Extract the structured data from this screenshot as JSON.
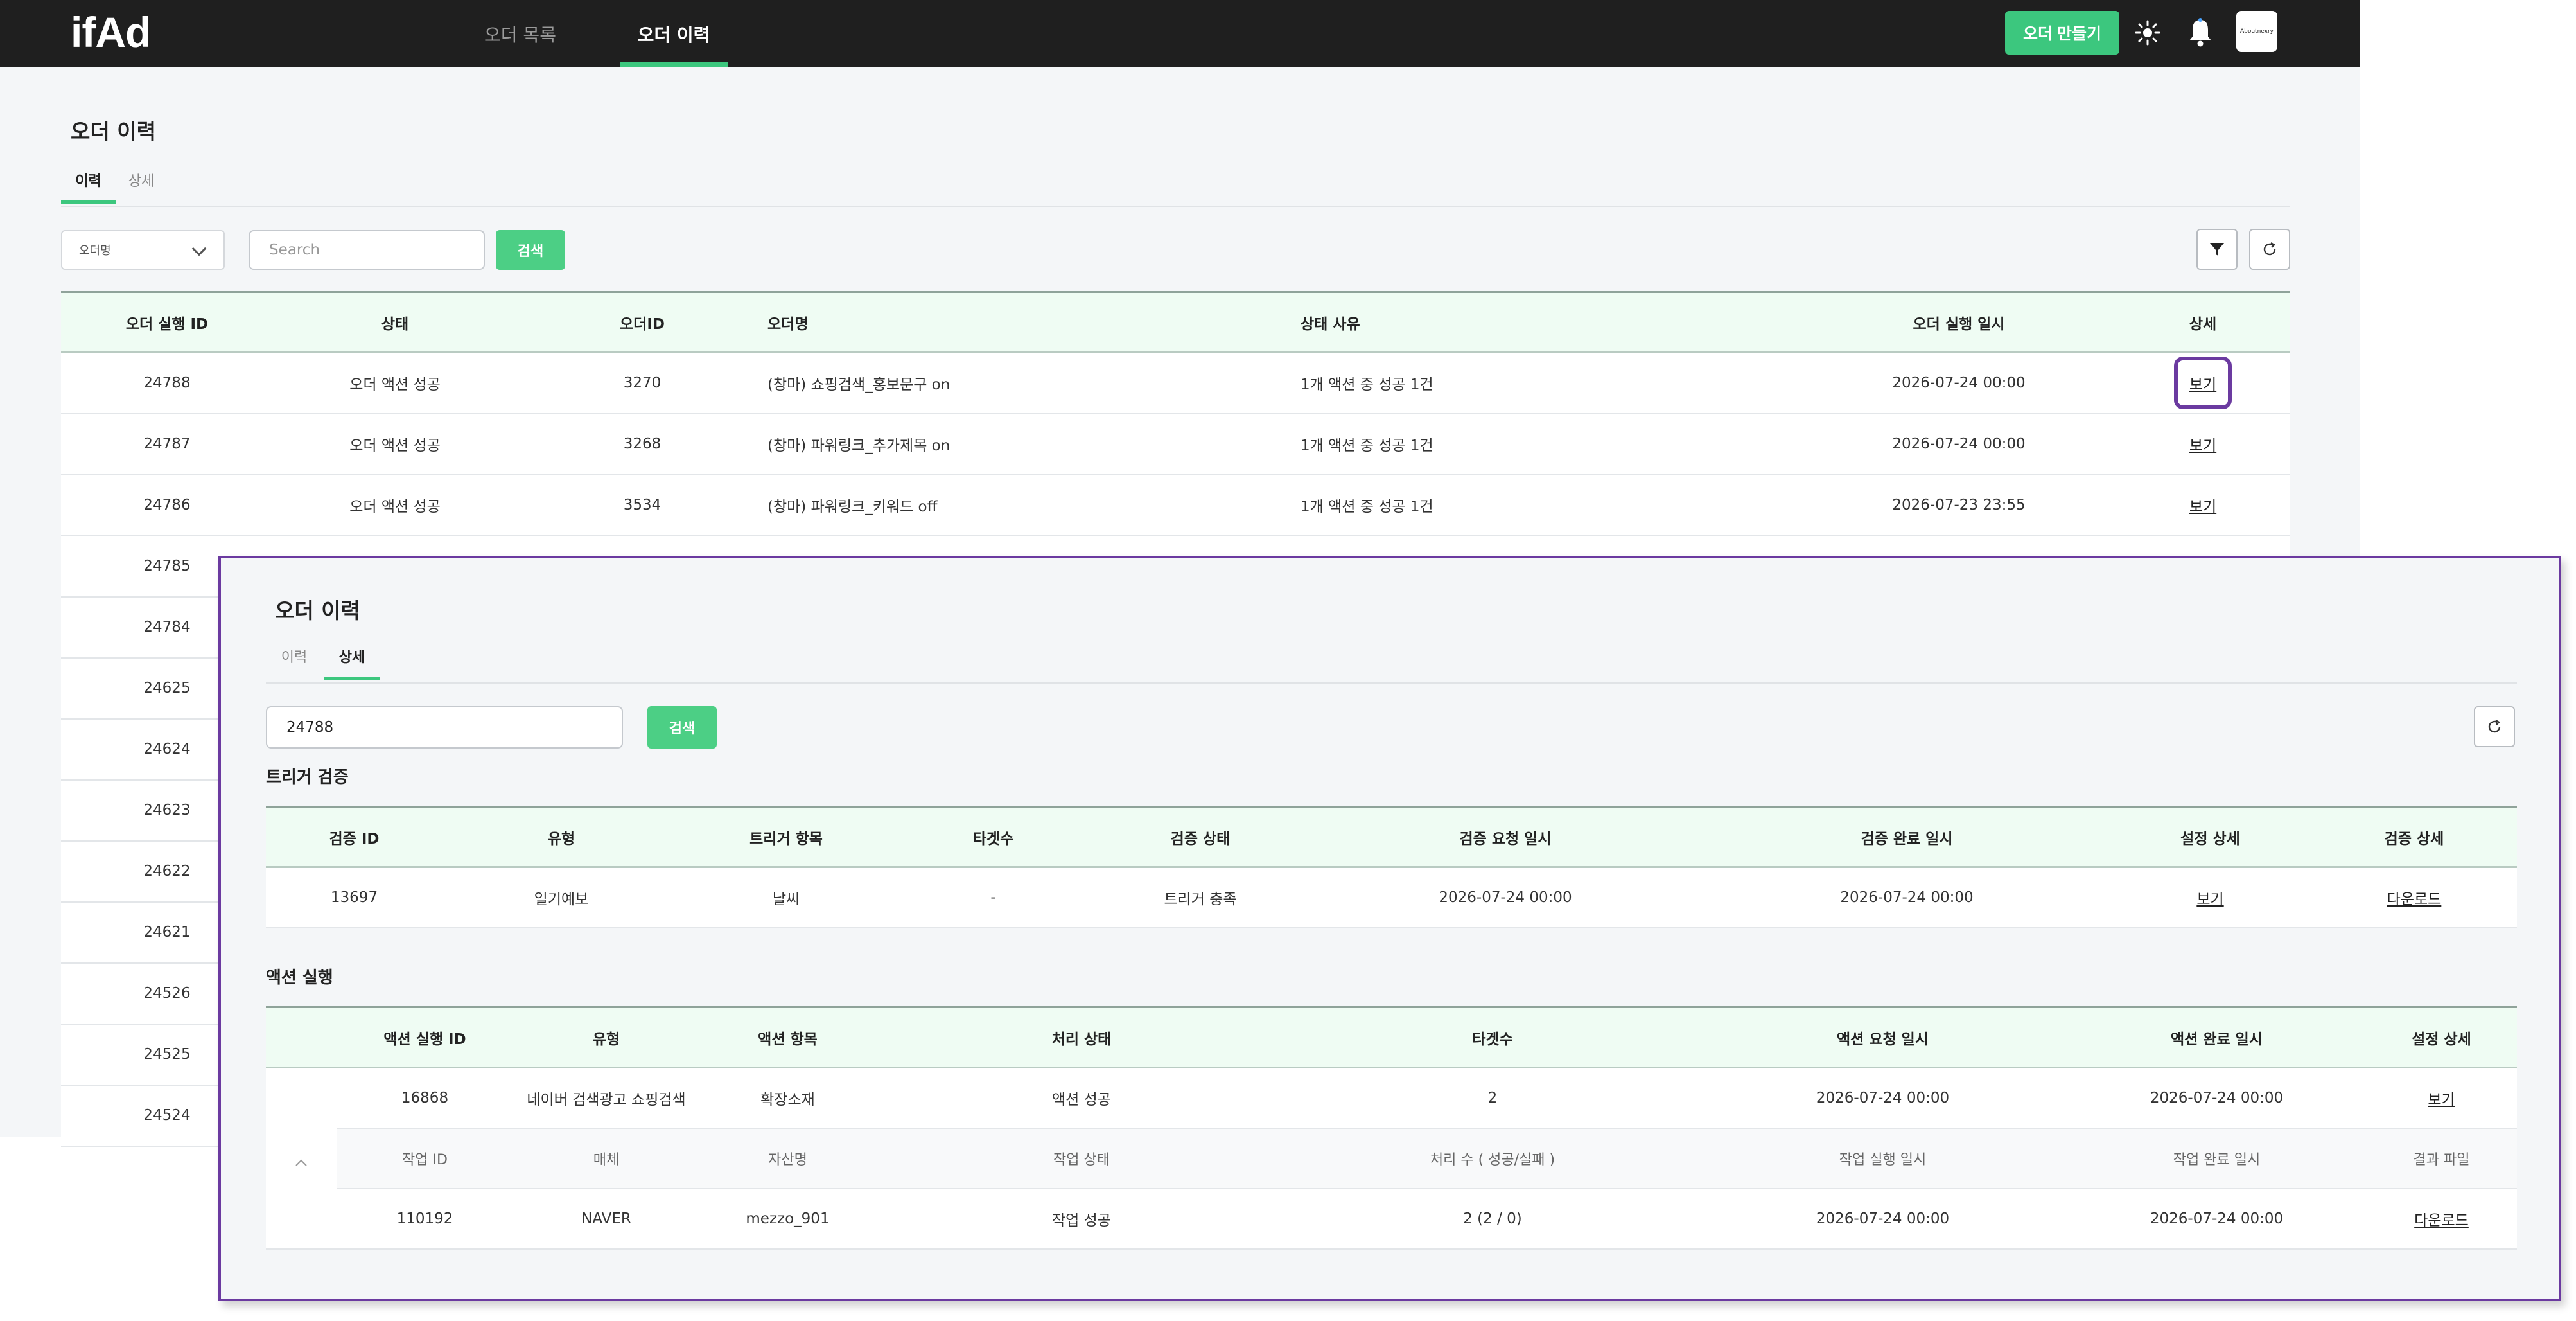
{
  "header": {
    "logo": "ifAd",
    "nav": [
      "오더 목록",
      "오더 이력"
    ],
    "create_button": "오더 만들기",
    "profile_label": "Aboutnexry"
  },
  "list": {
    "title": "오더 이력",
    "tabs": [
      "이력",
      "상세"
    ],
    "filter_select": "오더명",
    "search_placeholder": "Search",
    "search_button": "검색",
    "columns": [
      "오더 실행 ID",
      "상태",
      "오더ID",
      "오더명",
      "상태 사유",
      "오더 실행 일시",
      "상세"
    ],
    "rows": [
      {
        "id": "24788",
        "status": "오더 액션 성공",
        "order_id": "3270",
        "name": "(창마) 쇼핑검색_홍보문구 on",
        "reason": "1개 액션 중 성공 1건",
        "datetime": "2026-07-24 00:00",
        "detail": "보기"
      },
      {
        "id": "24787",
        "status": "오더 액션 성공",
        "order_id": "3268",
        "name": "(창마) 파워링크_추가제목 on",
        "reason": "1개 액션 중 성공 1건",
        "datetime": "2026-07-24 00:00",
        "detail": "보기"
      },
      {
        "id": "24786",
        "status": "오더 액션 성공",
        "order_id": "3534",
        "name": "(창마) 파워링크_키워드 off",
        "reason": "1개 액션 중 성공 1건",
        "datetime": "2026-07-23 23:55",
        "detail": "보기"
      },
      {
        "id": "24785"
      },
      {
        "id": "24784"
      },
      {
        "id": "24625"
      },
      {
        "id": "24624"
      },
      {
        "id": "24623"
      },
      {
        "id": "24622"
      },
      {
        "id": "24621"
      },
      {
        "id": "24526"
      },
      {
        "id": "24525"
      },
      {
        "id": "24524"
      }
    ]
  },
  "detail": {
    "title": "오더 이력",
    "tabs": [
      "이력",
      "상세"
    ],
    "search_value": "24788",
    "search_button": "검색",
    "trigger": {
      "title": "트리거 검증",
      "columns": [
        "검증 ID",
        "유형",
        "트리거 항목",
        "타겟수",
        "검증 상태",
        "검증 요청 일시",
        "검증 완료 일시",
        "설정 상세",
        "검증 상세"
      ],
      "row": [
        "13697",
        "일기예보",
        "날씨",
        "-",
        "트리거 충족",
        "2026-07-24 00:00",
        "2026-07-24 00:00",
        "보기",
        "다운로드"
      ]
    },
    "action": {
      "title": "액션 실행",
      "columns": [
        "액션 실행 ID",
        "유형",
        "액션 항목",
        "처리 상태",
        "타겟수",
        "액션 요청 일시",
        "액션 완료 일시",
        "설정 상세"
      ],
      "row": [
        "16868",
        "네이버 검색광고 쇼핑검색",
        "확장소재",
        "액션 성공",
        "2",
        "2026-07-24 00:00",
        "2026-07-24 00:00",
        "보기"
      ],
      "sub_columns": [
        "작업 ID",
        "매체",
        "자산명",
        "작업 상태",
        "처리 수 ( 성공/실패 )",
        "작업 실행 일시",
        "작업 완료 일시",
        "결과 파일"
      ],
      "sub_row": [
        "110192",
        "NAVER",
        "mezzo_901",
        "작업 성공",
        "2 (2 / 0)",
        "2026-07-24 00:00",
        "2026-07-24 00:00",
        "다운로드"
      ]
    }
  }
}
